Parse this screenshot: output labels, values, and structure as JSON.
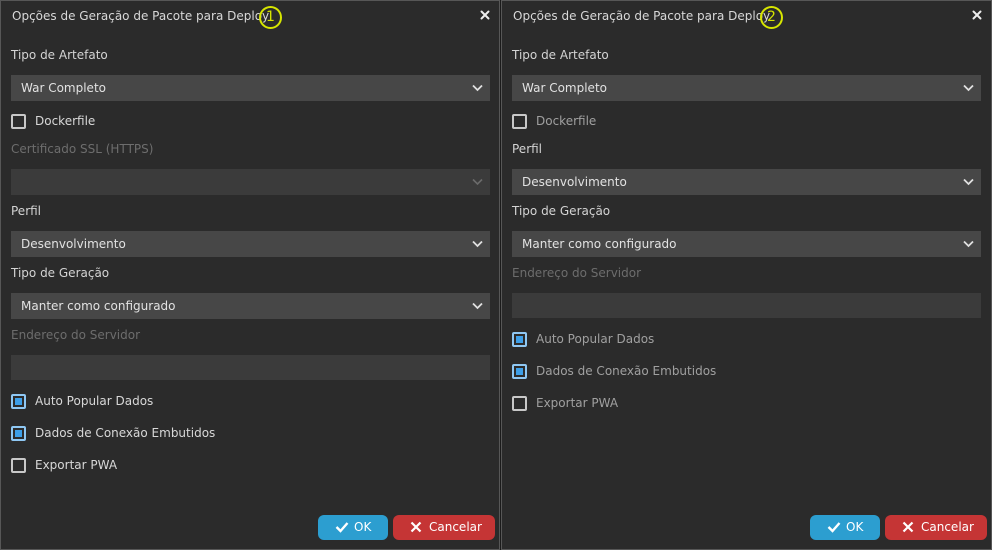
{
  "dialogs": [
    {
      "title": "Opções de Geração de Pacote para Deploy",
      "step": "1",
      "artifact_label": "Tipo de Artefato",
      "artifact_value": "War Completo",
      "dockerfile_label": "Dockerfile",
      "dockerfile_checked": false,
      "ssl_label": "Certificado SSL (HTTPS)",
      "ssl_value": "",
      "profile_label": "Perfil",
      "profile_value": "Desenvolvimento",
      "gen_label": "Tipo de Geração",
      "gen_value": "Manter como configurado",
      "server_label": "Endereço do Servidor",
      "server_value": "",
      "auto_label": "Auto Popular Dados",
      "auto_checked": true,
      "embedded_label": "Dados de Conexão Embutidos",
      "embedded_checked": true,
      "pwa_label": "Exportar PWA",
      "pwa_checked": false,
      "ok_label": "OK",
      "cancel_label": "Cancelar"
    },
    {
      "title": "Opções de Geração de Pacote para Deploy",
      "step": "2",
      "artifact_label": "Tipo de Artefato",
      "artifact_value": "War Completo",
      "dockerfile_label": "Dockerfile",
      "dockerfile_checked": false,
      "profile_label": "Perfil",
      "profile_value": "Desenvolvimento",
      "gen_label": "Tipo de Geração",
      "gen_value": "Manter como configurado",
      "server_label": "Endereço do Servidor",
      "server_value": "",
      "auto_label": "Auto Popular Dados",
      "auto_checked": true,
      "embedded_label": "Dados de Conexão Embutidos",
      "embedded_checked": true,
      "pwa_label": "Exportar PWA",
      "pwa_checked": false,
      "ok_label": "OK",
      "cancel_label": "Cancelar"
    }
  ],
  "icons": {
    "close": "close-icon",
    "dropdown": "chevron-down-icon",
    "ok": "check-icon",
    "cancel": "x-icon"
  },
  "colors": {
    "background": "#2b2b2b",
    "input": "#474747",
    "step_marker": "#d7e600",
    "check_accent": "#3d9fe8",
    "ok_button": "#2c9ed0",
    "cancel_button": "#c53535"
  }
}
